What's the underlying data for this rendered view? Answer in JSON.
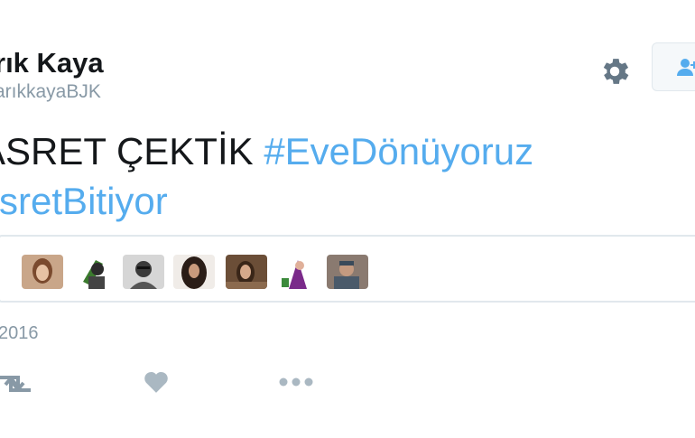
{
  "author": {
    "name": "rık Kaya",
    "handle": "arıkkayaBJK"
  },
  "icons": {
    "settings": "gear-icon",
    "follow": "user-follow-icon",
    "retweet": "retweet-icon",
    "like": "heart-icon",
    "more": "more-dots-icon"
  },
  "tweet": {
    "text_line1_plain": "ASRET ÇEKTİK ",
    "text_line1_hashtag": "#EveDönüyoruz",
    "text_line2_hashtag": "#HasretBitiyor",
    "timestamp": "2016"
  },
  "likers": [
    {
      "name": "liker-1"
    },
    {
      "name": "liker-2"
    },
    {
      "name": "liker-3"
    },
    {
      "name": "liker-4"
    },
    {
      "name": "liker-5"
    },
    {
      "name": "liker-6"
    },
    {
      "name": "liker-7"
    }
  ],
  "colors": {
    "hashtag": "#55acee",
    "muted": "#8899a6",
    "text": "#14171a",
    "border": "#e1e8ed",
    "icon": "#657786"
  }
}
